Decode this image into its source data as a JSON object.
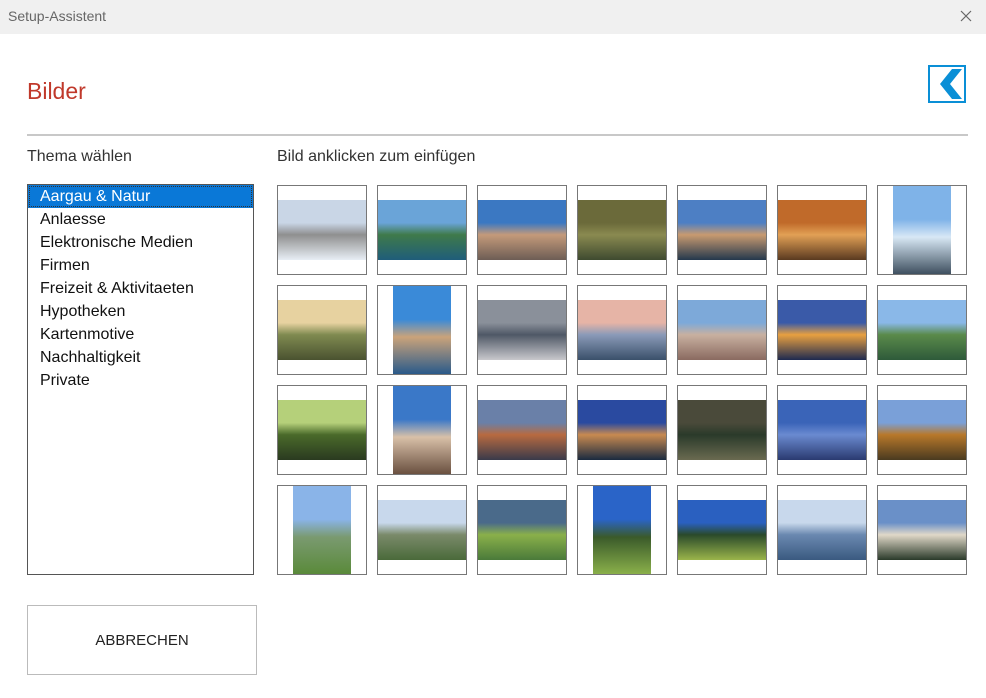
{
  "window": {
    "title": "Setup-Assistent",
    "close_icon": "close-icon"
  },
  "page": {
    "heading": "Bilder",
    "logo_icon": "bank-chevron-logo",
    "accent_color": "#c0392b",
    "logo_color": "#0a8fd6"
  },
  "theme_panel": {
    "label": "Thema wählen",
    "selected_index": 0,
    "items": [
      "Aargau & Natur",
      "Anlaesse",
      "Elektronische Medien",
      "Firmen",
      "Freizeit & Aktivitaeten",
      "Hypotheken",
      "Kartenmotive",
      "Nachhaltigkeit",
      "Private"
    ]
  },
  "gallery": {
    "label": "Bild anklicken zum einfügen",
    "images": [
      {
        "name": "image-town-river-winter",
        "orientation": "landscape",
        "colors": [
          "#c9d6e6",
          "#8f8f8f",
          "#e8eef5"
        ]
      },
      {
        "name": "image-river-trees",
        "orientation": "landscape",
        "colors": [
          "#6aa4d8",
          "#3f7a4a",
          "#1f5d7a"
        ]
      },
      {
        "name": "image-old-town-facades",
        "orientation": "landscape",
        "colors": [
          "#3b78c2",
          "#c49a7a",
          "#6d5d55"
        ]
      },
      {
        "name": "image-reed-lake",
        "orientation": "landscape",
        "colors": [
          "#6b6a3a",
          "#8a8a50",
          "#3e4a30"
        ]
      },
      {
        "name": "image-river-sunset-bridge",
        "orientation": "landscape",
        "colors": [
          "#4d7fc4",
          "#c89a70",
          "#24384d"
        ]
      },
      {
        "name": "image-flowers-bokeh",
        "orientation": "landscape",
        "colors": [
          "#c06a2a",
          "#e2a055",
          "#5a3a20"
        ]
      },
      {
        "name": "image-town-riverside-portrait",
        "orientation": "portrait",
        "colors": [
          "#7fb3e8",
          "#d8e8f5",
          "#3f5060"
        ]
      },
      {
        "name": "image-meadow-sunrise",
        "orientation": "landscape",
        "colors": [
          "#e7d2a0",
          "#7f8a50",
          "#4a5230"
        ]
      },
      {
        "name": "image-town-river-portrait",
        "orientation": "portrait",
        "colors": [
          "#3a8ad8",
          "#caa37a",
          "#2a5a8a"
        ]
      },
      {
        "name": "image-dramatic-clouds",
        "orientation": "landscape",
        "colors": [
          "#8a909a",
          "#4f5866",
          "#c8c8cc"
        ]
      },
      {
        "name": "image-alps-lake-dusk",
        "orientation": "landscape",
        "colors": [
          "#e6b4a6",
          "#8a9ab8",
          "#3a506a"
        ]
      },
      {
        "name": "image-town-street-tower",
        "orientation": "landscape",
        "colors": [
          "#7da9d9",
          "#c8b0a0",
          "#8a6a60"
        ]
      },
      {
        "name": "image-castle-night-lights",
        "orientation": "landscape",
        "colors": [
          "#3a5aa8",
          "#e8a040",
          "#1e2a50"
        ]
      },
      {
        "name": "image-river-town-green",
        "orientation": "landscape",
        "colors": [
          "#8ab8e8",
          "#5a8a4a",
          "#2e5a3a"
        ]
      },
      {
        "name": "image-tree-canopy",
        "orientation": "landscape",
        "colors": [
          "#b5d07a",
          "#4a6a2a",
          "#2a3a20"
        ]
      },
      {
        "name": "image-church-tower-portrait",
        "orientation": "portrait",
        "colors": [
          "#3a78c8",
          "#d8c0a8",
          "#6a5040"
        ]
      },
      {
        "name": "image-misty-evening-town",
        "orientation": "landscape",
        "colors": [
          "#6a80a8",
          "#b86a40",
          "#3a3a4a"
        ]
      },
      {
        "name": "image-riverside-town-dusk",
        "orientation": "landscape",
        "colors": [
          "#2a4aa0",
          "#c88a50",
          "#1a2a40"
        ]
      },
      {
        "name": "image-dark-pond-heron",
        "orientation": "landscape",
        "colors": [
          "#4a4a3a",
          "#2a3a2a",
          "#6a6a50"
        ]
      },
      {
        "name": "image-lake-blue-sky",
        "orientation": "landscape",
        "colors": [
          "#3a64b8",
          "#6a8ad0",
          "#2a3a70"
        ]
      },
      {
        "name": "image-autumn-lake-shore",
        "orientation": "landscape",
        "colors": [
          "#7aa0d8",
          "#b8782a",
          "#4a3a20"
        ]
      },
      {
        "name": "image-hill-view-lake-portrait",
        "orientation": "portrait",
        "colors": [
          "#8ab4e8",
          "#7a9a70",
          "#5a8a3a"
        ]
      },
      {
        "name": "image-lake-landscape-wide",
        "orientation": "landscape",
        "colors": [
          "#c8d8ec",
          "#7a8a6a",
          "#4a6a3a"
        ]
      },
      {
        "name": "image-green-field-storm",
        "orientation": "landscape",
        "colors": [
          "#4a6a8a",
          "#8ab04a",
          "#4a7a3a"
        ]
      },
      {
        "name": "image-single-tree-portrait",
        "orientation": "portrait",
        "colors": [
          "#2a64c8",
          "#3a5a2a",
          "#8ab04a"
        ]
      },
      {
        "name": "image-single-tree-field",
        "orientation": "landscape",
        "colors": [
          "#2a60c0",
          "#2a4a2a",
          "#9ab44a"
        ]
      },
      {
        "name": "image-hazy-mountain-valley",
        "orientation": "landscape",
        "colors": [
          "#c8d8ec",
          "#6a88b0",
          "#3a5a80"
        ]
      },
      {
        "name": "image-castle-moat-trees",
        "orientation": "landscape",
        "colors": [
          "#6a90c8",
          "#e0d8c8",
          "#2a3a2a"
        ]
      }
    ]
  },
  "actions": {
    "cancel_label": "ABBRECHEN"
  }
}
